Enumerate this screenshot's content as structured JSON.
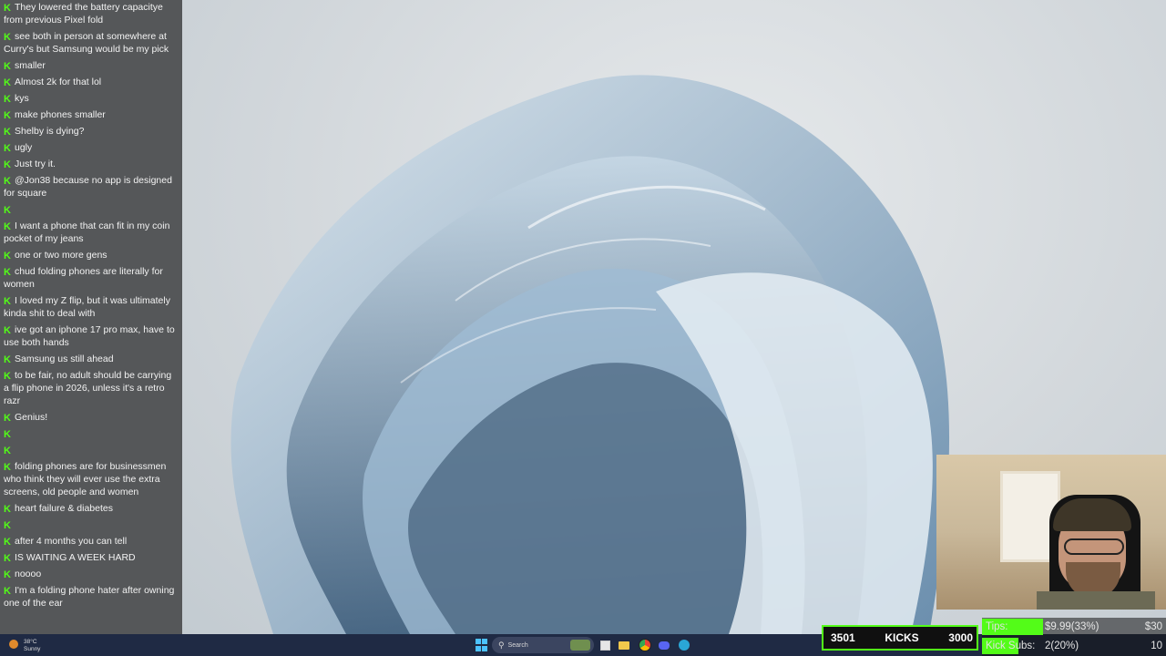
{
  "chat": {
    "messages": [
      {
        "user": "",
        "text": "They lowered the battery capacitye from previous Pixel fold"
      },
      {
        "user": "",
        "text": "see both in person at somewhere at Curry's but Samsung would be my pick"
      },
      {
        "user": "",
        "text": "smaller"
      },
      {
        "user": "",
        "text": "Almost 2k for that lol"
      },
      {
        "user": "",
        "text": "kys"
      },
      {
        "user": "",
        "text": "make phones smaller"
      },
      {
        "user": "",
        "text": "Shelby is dying?"
      },
      {
        "user": "",
        "text": "ugly"
      },
      {
        "user": "",
        "text": "Just try it."
      },
      {
        "user": "",
        "text": "@Jon38 because no app is designed for square"
      },
      {
        "user": "",
        "text": ""
      },
      {
        "user": "",
        "text": "I want a phone that can fit in my coin pocket of my jeans"
      },
      {
        "user": "",
        "text": "one or two more gens"
      },
      {
        "user": "",
        "text": "chud folding phones are literally for women"
      },
      {
        "user": "",
        "text": "I loved my Z flip, but it was ultimately kinda shit to deal with"
      },
      {
        "user": "",
        "text": "ive got an iphone 17 pro max, have to use both hands"
      },
      {
        "user": "",
        "text": "Samsung us still ahead"
      },
      {
        "user": "",
        "text": "to be fair, no adult should be carrying a flip phone in 2026, unless it's a retro razr"
      },
      {
        "user": "",
        "text": "Genius!"
      },
      {
        "user": "",
        "text": ""
      },
      {
        "user": "",
        "text": ""
      },
      {
        "user": "",
        "text": "folding phones are for businessmen who think they will ever use the extra screens, old people and women"
      },
      {
        "user": "",
        "text": "heart failure & diabetes"
      },
      {
        "user": "",
        "text": ""
      },
      {
        "user": "",
        "text": "after 4 months you can tell"
      },
      {
        "user": "",
        "text": "IS WAITING A WEEK HARD"
      },
      {
        "user": "",
        "text": "noooo"
      },
      {
        "user": "",
        "text": "I'm a folding phone hater after owning one of the ear"
      }
    ]
  },
  "taskbar": {
    "search_placeholder": "Search",
    "start_icon": "windows-start-icon",
    "weather_line1": "38°C",
    "weather_line2": "Sunny"
  },
  "stats": {
    "kicks_left": "3501",
    "kicks_label": "KICKS",
    "kicks_right": "3000",
    "tips_label": "Tips:",
    "tips_value": "$9.99(33%)",
    "tips_goal": "$30",
    "tips_progress": 0.33,
    "subs_label": "Kick Subs:",
    "subs_value": "2(20%)",
    "subs_goal": "10",
    "subs_progress": 0.2
  },
  "colors": {
    "kick_green": "#53fc18",
    "taskbar": "#1f2a44",
    "username_blue": "#3b5bdb"
  }
}
